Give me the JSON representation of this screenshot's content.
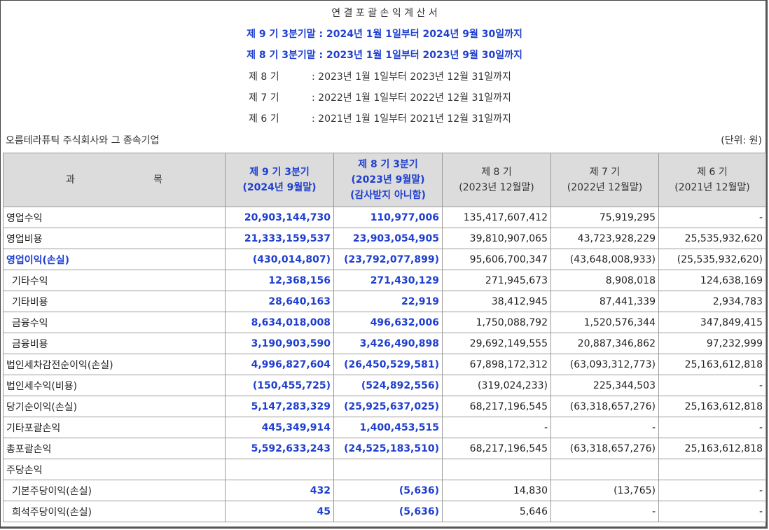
{
  "title": "연 결 포 괄 손 익 계 산 서",
  "current_periods": [
    "제 9 기 3분기말 : 2024년 1월 1일부터 2024년 9월 30일까지",
    "제 8 기 3분기말 : 2023년 1월 1일부터 2023년 9월 30일까지"
  ],
  "prior_periods": [
    {
      "label": "제 8 기",
      "range": ": 2023년 1월 1일부터 2023년 12월 31일까지"
    },
    {
      "label": "제 7 기",
      "range": ": 2022년 1월 1일부터 2022년 12월 31일까지"
    },
    {
      "label": "제 6 기",
      "range": ": 2021년 1월 1일부터 2021년 12월 31일까지"
    }
  ],
  "company": "오름테라퓨틱 주식회사와 그 종속기업",
  "unit": "(단위: 원)",
  "header": {
    "subject_left": "과",
    "subject_right": "목",
    "columns": [
      {
        "line1": "제 9 기 3분기",
        "line2": "(2024년 9월말)",
        "line3": ""
      },
      {
        "line1": "제 8 기 3분기",
        "line2": "(2023년 9월말)",
        "line3": "(감사받지 아니함)"
      },
      {
        "line1": "제 8 기",
        "line2": "(2023년 12월말)",
        "line3": ""
      },
      {
        "line1": "제 7 기",
        "line2": "(2022년 12월말)",
        "line3": ""
      },
      {
        "line1": "제 6 기",
        "line2": "(2021년 12월말)",
        "line3": ""
      }
    ]
  },
  "rows": [
    {
      "label": "영업수익",
      "v": [
        "20,903,144,730",
        "110,977,006",
        "135,417,607,412",
        "75,919,295",
        "-"
      ]
    },
    {
      "label": "영업비용",
      "v": [
        "21,333,159,537",
        "23,903,054,905",
        "39,810,907,065",
        "43,723,928,229",
        "25,535,932,620"
      ]
    },
    {
      "label": "영업이익(손실)",
      "v": [
        "(430,014,807)",
        "(23,792,077,899)",
        "95,606,700,347",
        "(43,648,008,933)",
        "(25,535,932,620)"
      ]
    },
    {
      "label": "기타수익",
      "v": [
        "12,368,156",
        "271,430,129",
        "271,945,673",
        "8,908,018",
        "124,638,169"
      ]
    },
    {
      "label": "기타비용",
      "v": [
        "28,640,163",
        "22,919",
        "38,412,945",
        "87,441,339",
        "2,934,783"
      ]
    },
    {
      "label": "금융수익",
      "v": [
        "8,634,018,008",
        "496,632,006",
        "1,750,088,792",
        "1,520,576,344",
        "347,849,415"
      ]
    },
    {
      "label": "금융비용",
      "v": [
        "3,190,903,590",
        "3,426,490,898",
        "29,692,149,555",
        "20,887,346,862",
        "97,232,999"
      ]
    },
    {
      "label": "법인세차감전순이익(손실)",
      "v": [
        "4,996,827,604",
        "(26,450,529,581)",
        "67,898,172,312",
        "(63,093,312,773)",
        "25,163,612,818"
      ]
    },
    {
      "label": "법인세수익(비용)",
      "v": [
        "(150,455,725)",
        "(524,892,556)",
        "(319,024,233)",
        "225,344,503",
        "-"
      ]
    },
    {
      "label": "당기순이익(손실)",
      "v": [
        "5,147,283,329",
        "(25,925,637,025)",
        "68,217,196,545",
        "(63,318,657,276)",
        "25,163,612,818"
      ]
    },
    {
      "label": "기타포괄손익",
      "v": [
        "445,349,914",
        "1,400,453,515",
        "-",
        "-",
        "-"
      ]
    },
    {
      "label": "총포괄손익",
      "v": [
        "5,592,633,243",
        "(24,525,183,510)",
        "68,217,196,545",
        "(63,318,657,276)",
        "25,163,612,818"
      ]
    },
    {
      "label": "주당손익",
      "v": [
        "",
        "",
        "",
        "",
        ""
      ]
    },
    {
      "label": "기본주당이익(손실)",
      "v": [
        "432",
        "(5,636)",
        "14,830",
        "(13,765)",
        "-"
      ]
    },
    {
      "label": "희석주당이익(손실)",
      "v": [
        "45",
        "(5,636)",
        "5,646",
        "-",
        "-"
      ]
    }
  ]
}
